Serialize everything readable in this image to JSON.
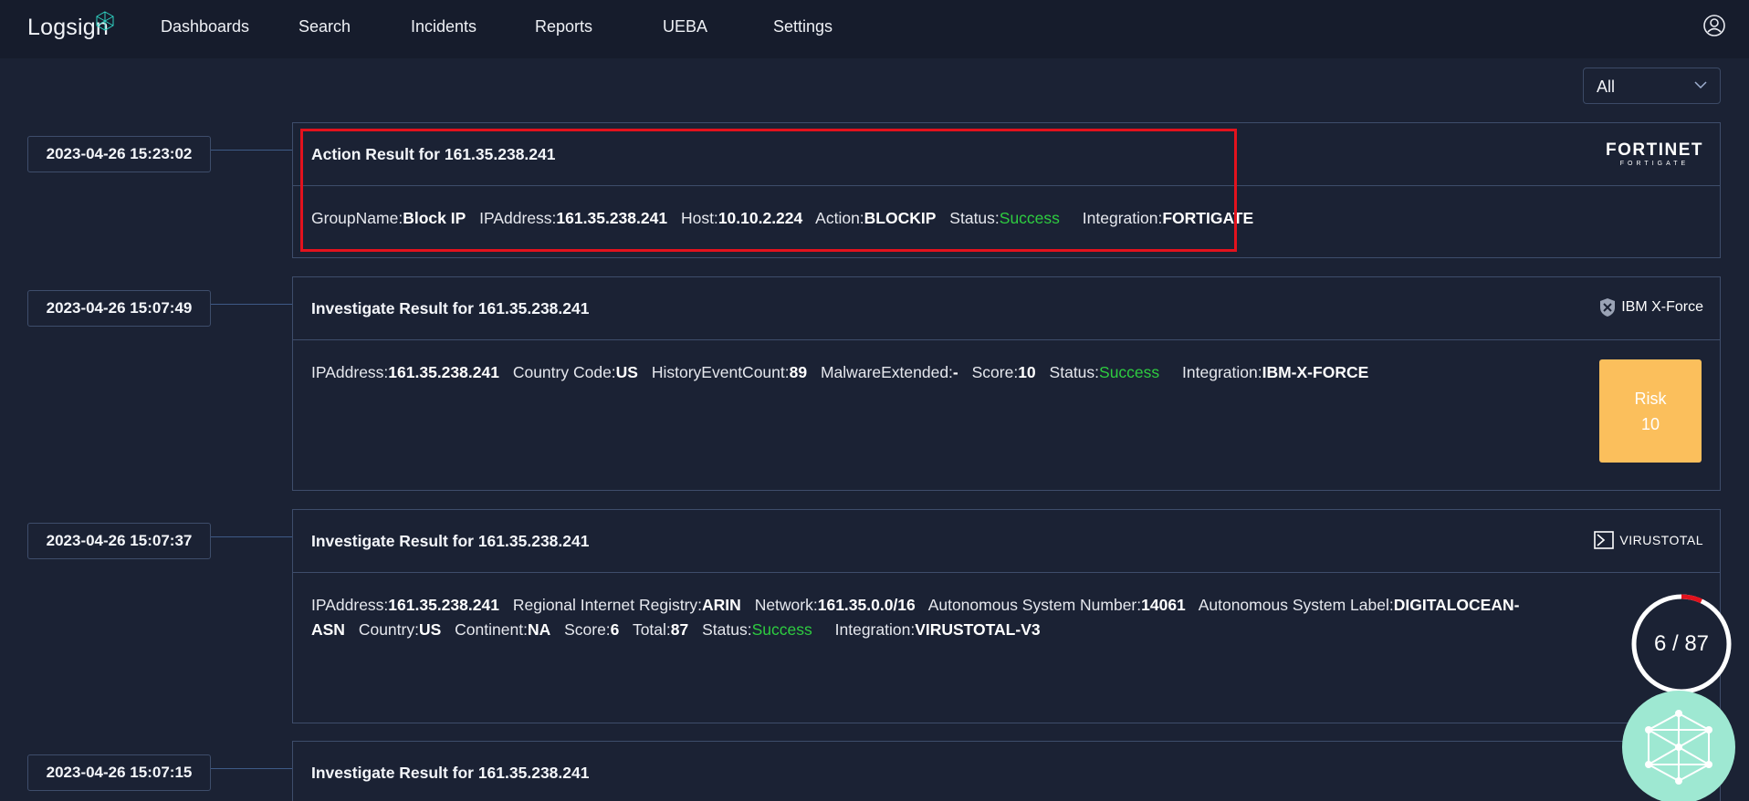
{
  "app": {
    "logo_text": "Logsign"
  },
  "nav": {
    "items": [
      {
        "label": "Dashboards"
      },
      {
        "label": "Search"
      },
      {
        "label": "Incidents"
      },
      {
        "label": "Reports"
      },
      {
        "label": "UEBA"
      },
      {
        "label": "Settings"
      }
    ]
  },
  "filter": {
    "selected": "All"
  },
  "timeline": [
    {
      "timestamp": "2023-04-26 15:23:02",
      "title": "Action Result for 161.35.238.241",
      "brand": "FORTINET",
      "brand_sub": "FORTIGATE",
      "fields": [
        {
          "label": "GroupName:",
          "value": "Block IP"
        },
        {
          "label": "IPAddress:",
          "value": "161.35.238.241"
        },
        {
          "label": "Host:",
          "value": "10.10.2.224"
        },
        {
          "label": "Action:",
          "value": "BLOCKIP"
        },
        {
          "label": "Status:",
          "value": "Success"
        },
        {
          "label": "Integration:",
          "value": "FORTIGATE"
        }
      ]
    },
    {
      "timestamp": "2023-04-26 15:07:49",
      "title": "Investigate Result for 161.35.238.241",
      "brand": "IBM X-Force",
      "risk_label": "Risk",
      "risk_value": "10",
      "fields": [
        {
          "label": "IPAddress:",
          "value": "161.35.238.241"
        },
        {
          "label": "Country Code:",
          "value": "US"
        },
        {
          "label": "HistoryEventCount:",
          "value": "89"
        },
        {
          "label": "MalwareExtended:",
          "value": "-"
        },
        {
          "label": "Score:",
          "value": "10"
        },
        {
          "label": "Status:",
          "value": "Success"
        },
        {
          "label": "Integration:",
          "value": "IBM-X-FORCE"
        }
      ]
    },
    {
      "timestamp": "2023-04-26 15:07:37",
      "title": "Investigate Result for 161.35.238.241",
      "brand": "VIRUSTOTAL",
      "detection_text": "6 / 87",
      "detection_ratio": 0.069,
      "fields": [
        {
          "label": "IPAddress:",
          "value": "161.35.238.241"
        },
        {
          "label": "Regional Internet Registry:",
          "value": "ARIN"
        },
        {
          "label": "Network:",
          "value": "161.35.0.0/16"
        },
        {
          "label": "Autonomous System Number:",
          "value": "14061"
        },
        {
          "label": "Autonomous System Label:",
          "value": "DIGITALOCEAN-ASN"
        },
        {
          "label": "Country:",
          "value": "US"
        },
        {
          "label": "Continent:",
          "value": "NA"
        },
        {
          "label": "Score:",
          "value": "6"
        },
        {
          "label": "Total:",
          "value": "87"
        },
        {
          "label": "Status:",
          "value": "Success"
        },
        {
          "label": "Integration:",
          "value": "VIRUSTOTAL-V3"
        }
      ]
    },
    {
      "timestamp": "2023-04-26 15:07:15",
      "title": "Investigate Result for 161.35.238.241"
    }
  ],
  "colors": {
    "background": "#1b2234",
    "topbar": "#161c2c",
    "success": "#2ecc40",
    "risk": "#fbbf5c",
    "highlight": "#e3121d",
    "donut_accent": "#e3121d",
    "assistant": "#9ee8d2"
  }
}
